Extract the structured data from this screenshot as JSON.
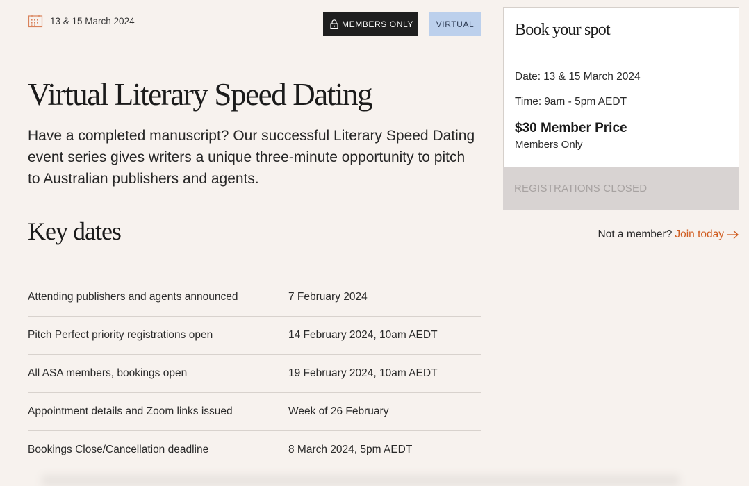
{
  "event": {
    "date_display": "13 & 15 March 2024",
    "tags": {
      "members_only": "MEMBERS ONLY",
      "virtual": "VIRTUAL"
    },
    "title": "Virtual Literary Speed Dating",
    "intro": "Have a completed manuscript? Our successful Literary Speed Dating event series gives writers a unique three-minute opportunity to pitch to Australian publishers and agents."
  },
  "key_dates": {
    "heading": "Key dates",
    "rows": [
      {
        "label": "Attending publishers and agents announced",
        "value": "7 February 2024"
      },
      {
        "label": "Pitch Perfect priority registrations open",
        "value": "14 February 2024, 10am AEDT"
      },
      {
        "label": "All ASA members, bookings open",
        "value": "19 February 2024, 10am AEDT"
      },
      {
        "label": "Appointment details and Zoom links issued",
        "value": "Week of 26 February"
      },
      {
        "label": "Bookings Close/Cancellation deadline",
        "value": "8 March 2024, 5pm AEDT"
      }
    ]
  },
  "booking": {
    "heading": "Book your spot",
    "date_label": "Date:",
    "date_value": "13 & 15 March 2024",
    "time_label": "Time:",
    "time_value": "9am - 5pm AEDT",
    "price": "$30 Member Price",
    "price_note": "Members Only",
    "button_label": "REGISTRATIONS CLOSED",
    "not_member_text": "Not a member?",
    "join_link": "Join today"
  },
  "colors": {
    "background": "#f7f2ee",
    "accent_link": "#d05c1f",
    "virtual_tag": "#bcd0ec",
    "members_tag": "#1f1f1f",
    "disabled_button": "#d8d3d2"
  },
  "icons": {
    "calendar": "calendar-icon",
    "lock": "lock-icon",
    "arrow": "arrow-right-icon"
  }
}
